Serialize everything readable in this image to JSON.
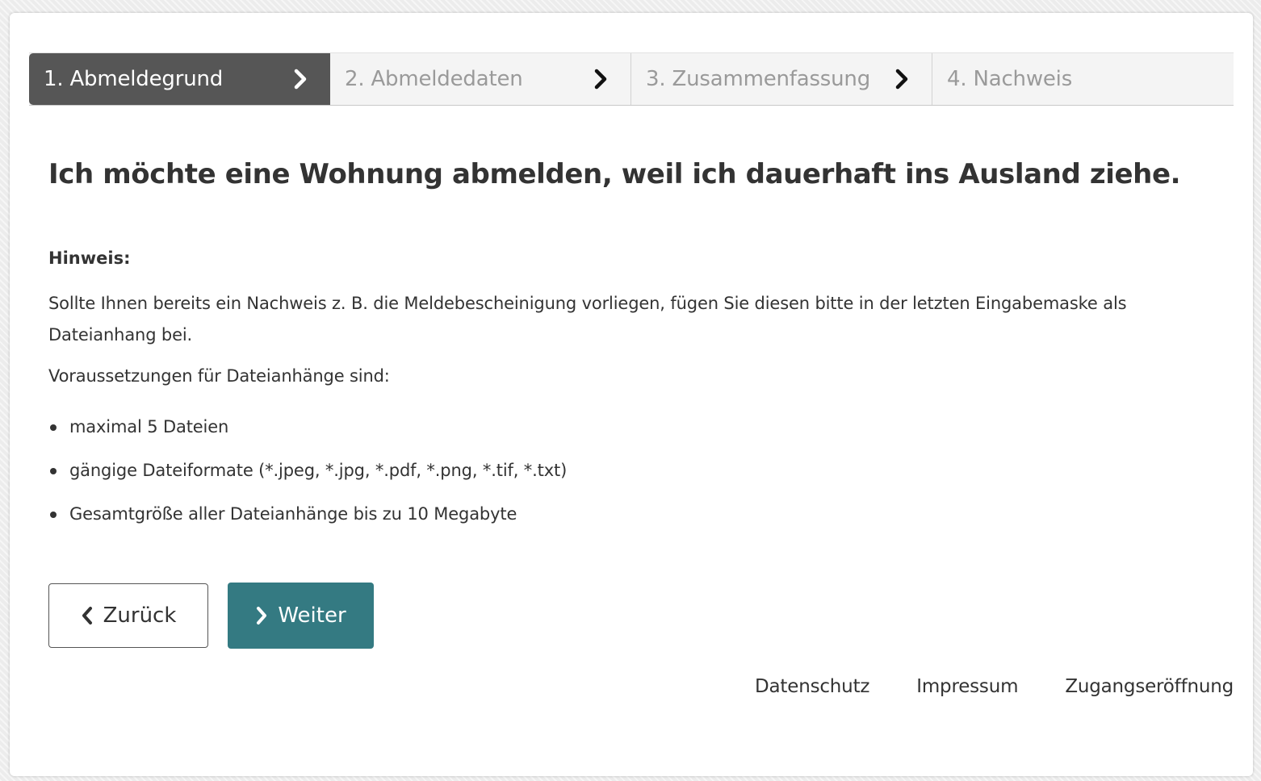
{
  "stepper": {
    "steps": [
      {
        "label": "1. Abmeldegrund",
        "active": true
      },
      {
        "label": "2. Abmeldedaten",
        "active": false
      },
      {
        "label": "3. Zusammenfassung",
        "active": false
      },
      {
        "label": "4. Nachweis",
        "active": false
      }
    ],
    "chevron_icon": "chevron-right-icon"
  },
  "main": {
    "heading": "Ich möchte eine Wohnung abmelden, weil ich dauerhaft ins Ausland ziehe.",
    "hint_title": "Hinweis:",
    "hint_text": "Sollte Ihnen bereits ein Nachweis z. B. die Meldebescheinigung vorliegen, fügen Sie diesen bitte in der letzten Eingabemaske als Dateianhang bei.",
    "prerequisites_intro": "Voraussetzungen für Dateianhänge sind:",
    "requirements": [
      "maximal 5 Dateien",
      "gängige Dateiformate (*.jpeg, *.jpg, *.pdf, *.png, *.tif, *.txt)",
      "Gesamtgröße aller Dateianhänge bis zu 10 Megabyte"
    ]
  },
  "buttons": {
    "back_label": "Zurück",
    "next_label": "Weiter"
  },
  "footer": {
    "links": [
      "Datenschutz",
      "Impressum",
      "Zugangseröffnung"
    ]
  },
  "colors": {
    "active_step": "#565656",
    "primary_button": "#347a82",
    "inactive_step_text": "#9a9a9a",
    "text": "#333333"
  }
}
